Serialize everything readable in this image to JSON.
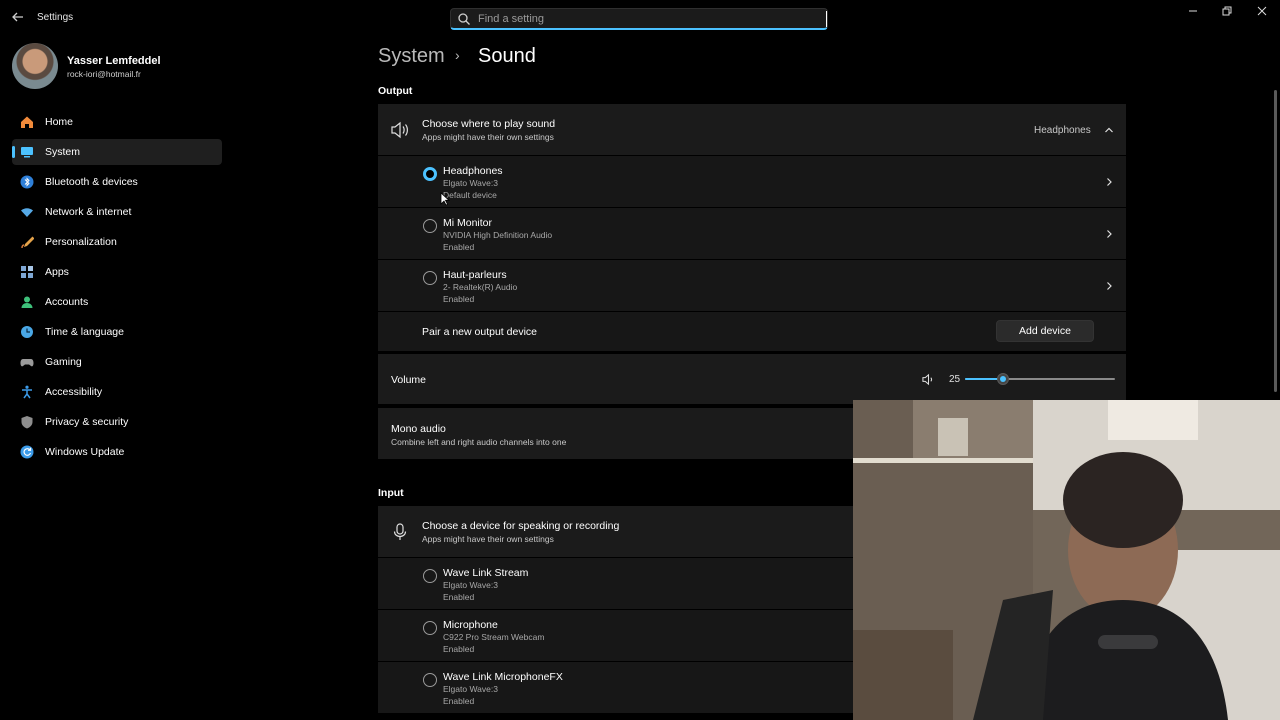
{
  "window": {
    "app_title": "Settings",
    "minimize_icon": "minimize-icon",
    "restore_icon": "restore-icon",
    "close_icon": "close-icon"
  },
  "search": {
    "placeholder": "Find a setting"
  },
  "profile": {
    "name": "Yasser Lemfeddel",
    "email": "rock-iori@hotmail.fr"
  },
  "sidebar": {
    "items": [
      {
        "label": "Home",
        "icon": "home-icon",
        "color": "#f28b3b"
      },
      {
        "label": "System",
        "icon": "system-icon",
        "color": "#4cc2ff",
        "active": true
      },
      {
        "label": "Bluetooth & devices",
        "icon": "bluetooth-icon",
        "color": "#2e7fd8"
      },
      {
        "label": "Network & internet",
        "icon": "network-icon",
        "color": "#56a9e6"
      },
      {
        "label": "Personalization",
        "icon": "brush-icon",
        "color": "#e5a34a"
      },
      {
        "label": "Apps",
        "icon": "apps-icon",
        "color": "#7ea7d4"
      },
      {
        "label": "Accounts",
        "icon": "accounts-icon",
        "color": "#3ec07a"
      },
      {
        "label": "Time & language",
        "icon": "globe-clock-icon",
        "color": "#4aa8e6"
      },
      {
        "label": "Gaming",
        "icon": "gamepad-icon",
        "color": "#9a9a9a"
      },
      {
        "label": "Accessibility",
        "icon": "accessibility-icon",
        "color": "#3c9be8"
      },
      {
        "label": "Privacy & security",
        "icon": "shield-icon",
        "color": "#8e8e8e"
      },
      {
        "label": "Windows Update",
        "icon": "update-icon",
        "color": "#3c9be8"
      }
    ]
  },
  "breadcrumb": {
    "parent": "System",
    "separator": "›",
    "current": "Sound"
  },
  "output": {
    "section_label": "Output",
    "choose": {
      "title": "Choose where to play sound",
      "subtitle": "Apps might have their own settings",
      "selected": "Headphones"
    },
    "devices": [
      {
        "name": "Headphones",
        "sub1": "Elgato Wave:3",
        "sub2": "Default device",
        "checked": true
      },
      {
        "name": "Mi Monitor",
        "sub1": "NVIDIA High Definition Audio",
        "sub2": "Enabled",
        "checked": false
      },
      {
        "name": "Haut-parleurs",
        "sub1": "2- Realtek(R) Audio",
        "sub2": "Enabled",
        "checked": false
      }
    ],
    "pair": {
      "label": "Pair a new output device",
      "button": "Add device"
    },
    "volume": {
      "label": "Volume",
      "value": "25",
      "level": 0.25
    },
    "mono": {
      "title": "Mono audio",
      "subtitle": "Combine left and right audio channels into one"
    }
  },
  "input": {
    "section_label": "Input",
    "choose": {
      "title": "Choose a device for speaking or recording",
      "subtitle": "Apps might have their own settings"
    },
    "devices": [
      {
        "name": "Wave Link Stream",
        "sub1": "Elgato Wave:3",
        "sub2": "Enabled"
      },
      {
        "name": "Microphone",
        "sub1": "C922 Pro Stream Webcam",
        "sub2": "Enabled"
      },
      {
        "name": "Wave Link MicrophoneFX",
        "sub1": "Elgato Wave:3",
        "sub2": "Enabled"
      }
    ]
  },
  "accent": "#4cc2ff"
}
